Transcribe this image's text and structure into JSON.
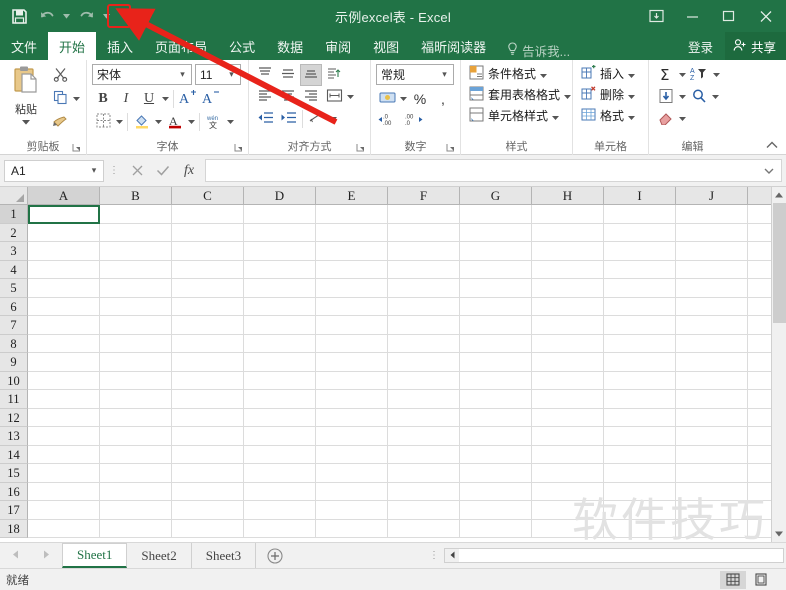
{
  "window": {
    "title": "示例excel表 - Excel",
    "accent_green": "#217346",
    "controls": {
      "ribbon_display": "ribbon-display-options-icon",
      "minimize": "minimize-icon",
      "maximize": "maximize-icon",
      "close": "close-icon"
    }
  },
  "quick_access": {
    "save": "save-icon",
    "undo": "undo-icon",
    "redo": "redo-icon",
    "customize": "customize-quick-access-toolbar-icon"
  },
  "ribbon_tabs": [
    {
      "label": "文件",
      "active": false
    },
    {
      "label": "开始",
      "active": true
    },
    {
      "label": "插入",
      "active": false
    },
    {
      "label": "页面布局",
      "active": false
    },
    {
      "label": "公式",
      "active": false
    },
    {
      "label": "数据",
      "active": false
    },
    {
      "label": "审阅",
      "active": false
    },
    {
      "label": "视图",
      "active": false
    },
    {
      "label": "福昕阅读器",
      "active": false
    }
  ],
  "tell_me": {
    "icon": "lightbulb-icon",
    "label": "告诉我..."
  },
  "account": {
    "sign_in": "登录",
    "share": "共享",
    "share_icon": "share-person-icon"
  },
  "ribbon": {
    "groups": [
      {
        "name": "clipboard",
        "label": "剪贴板",
        "paste_label": "粘贴",
        "paste_icon": "clipboard-paste-icon",
        "cut_icon": "scissors-icon",
        "copy_icon": "copy-icon",
        "format_painter_icon": "format-painter-icon",
        "dialog_launcher": "dialog-launcher-icon"
      },
      {
        "name": "font",
        "label": "字体",
        "font_name": "宋体",
        "font_size": "11",
        "bold": "B",
        "italic": "I",
        "underline": "U",
        "grow_font": "A",
        "shrink_font": "A",
        "borders_icon": "borders-icon",
        "fill_color_icon": "fill-color-icon",
        "font_color_icon": "font-color-icon",
        "phonetic_icon": "phonetic-guide-icon",
        "dialog_launcher": "dialog-launcher-icon"
      },
      {
        "name": "alignment",
        "label": "对齐方式",
        "align_top_icon": "align-top-icon",
        "align_middle_icon": "align-middle-icon",
        "align_bottom_icon": "align-bottom-icon",
        "orientation_icon": "text-orientation-icon",
        "align_left_icon": "align-left-icon",
        "align_center_icon": "align-center-icon",
        "align_right_icon": "align-right-icon",
        "wrap_text_icon": "wrap-text-icon",
        "decrease_indent_icon": "decrease-indent-icon",
        "increase_indent_icon": "increase-indent-icon",
        "merge_center_icon": "merge-and-center-icon",
        "dialog_launcher": "dialog-launcher-icon"
      },
      {
        "name": "number",
        "label": "数字",
        "format": "常规",
        "accounting_icon": "accounting-format-icon",
        "percent": "%",
        "comma": ",",
        "increase_decimal_icon": "increase-decimal-icon",
        "decrease_decimal_icon": "decrease-decimal-icon",
        "dialog_launcher": "dialog-launcher-icon"
      },
      {
        "name": "styles",
        "label": "样式",
        "items": [
          {
            "label": "条件格式",
            "icon": "conditional-formatting-icon"
          },
          {
            "label": "套用表格格式",
            "icon": "format-as-table-icon"
          },
          {
            "label": "单元格样式",
            "icon": "cell-styles-icon"
          }
        ]
      },
      {
        "name": "cells",
        "label": "单元格",
        "items": [
          {
            "label": "插入",
            "icon": "insert-cells-icon"
          },
          {
            "label": "删除",
            "icon": "delete-cells-icon"
          },
          {
            "label": "格式",
            "icon": "format-cells-icon"
          }
        ]
      },
      {
        "name": "editing",
        "label": "编辑",
        "autosum_icon": "autosum-icon",
        "sort_filter_icon": "sort-and-filter-icon",
        "fill_icon": "fill-down-icon",
        "find_select_icon": "find-and-select-icon",
        "clear_icon": "clear-eraser-icon"
      }
    ],
    "collapse_icon": "collapse-ribbon-chevron-icon"
  },
  "formula_bar": {
    "name_box_value": "A1",
    "name_box_caret": "chevron-down-icon",
    "cancel_icon": "cancel-x-icon",
    "enter_icon": "enter-check-icon",
    "function_icon": "fx",
    "value": "",
    "expand_icon": "expand-formula-bar-icon"
  },
  "grid": {
    "columns": [
      "A",
      "B",
      "C",
      "D",
      "E",
      "F",
      "G",
      "H",
      "I",
      "J"
    ],
    "rows": [
      "1",
      "2",
      "3",
      "4",
      "5",
      "6",
      "7",
      "8",
      "9",
      "10",
      "11",
      "12",
      "13",
      "14",
      "15",
      "16",
      "17",
      "18"
    ],
    "active_cell": "A1",
    "scroll_up_icon": "scroll-up-arrow-icon",
    "scroll_down_icon": "scroll-down-arrow-icon"
  },
  "sheet_bar": {
    "prev_icon": "previous-sheet-arrow-icon",
    "next_icon": "next-sheet-arrow-icon",
    "tabs": [
      {
        "label": "Sheet1",
        "active": true
      },
      {
        "label": "Sheet2",
        "active": false
      },
      {
        "label": "Sheet3",
        "active": false
      }
    ],
    "add_sheet_icon": "add-sheet-plus-icon",
    "hscroll_left_icon": "scroll-left-arrow-icon"
  },
  "status_bar": {
    "text": "就绪",
    "normal_view_icon": "normal-view-icon",
    "page_layout_icon": "page-layout-view-icon"
  },
  "watermark": {
    "text": "软件技巧"
  },
  "annotation": {
    "highlight_target": "customize-quick-access-toolbar-icon",
    "arrow_color": "#e8231a",
    "highlight_color": "#e8231a"
  }
}
